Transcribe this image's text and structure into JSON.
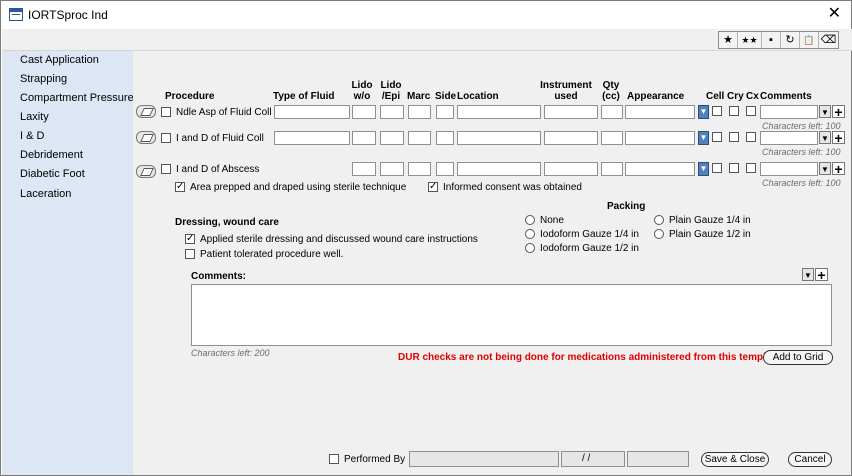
{
  "window": {
    "title": "IORTSproc Ind",
    "close_glyph": "✕"
  },
  "toolbar": {
    "buttons": [
      {
        "name": "favorite-star-icon",
        "glyph": "★"
      },
      {
        "name": "favorites-list-icon",
        "glyph": "★★"
      },
      {
        "name": "save-disk-icon",
        "glyph": "▪"
      },
      {
        "name": "refresh-icon",
        "glyph": "↻"
      },
      {
        "name": "clipboard-check-icon",
        "glyph": "📋"
      },
      {
        "name": "eraser-icon",
        "glyph": "⌫"
      }
    ]
  },
  "sidebar": {
    "items": [
      {
        "label": "Cast Application"
      },
      {
        "label": "Strapping"
      },
      {
        "label": "Compartment Pressures"
      },
      {
        "label": "Laxity"
      },
      {
        "label": "I & D"
      },
      {
        "label": "Debridement"
      },
      {
        "label": "Diabetic Foot"
      },
      {
        "label": "Laceration"
      }
    ]
  },
  "grid": {
    "headers": {
      "procedure": "Procedure",
      "type_of_fluid": "Type of Fluid",
      "lido_wo": "Lido w/o",
      "lido_epi": "Lido /Epi",
      "marc": "Marc",
      "side": "Side",
      "location": "Location",
      "instrument_used": "Instrument used",
      "qty": "Qty (cc)",
      "appearance": "Appearance",
      "cell": "Cell",
      "cry": "Cry",
      "cx": "Cx",
      "comments": "Comments"
    },
    "rows": [
      {
        "label": "Ndle Asp of Fluid Coll",
        "chars_left": "Characters left: 100"
      },
      {
        "label": "I and D of Fluid Coll",
        "chars_left": "Characters left: 100"
      },
      {
        "label": "I and D of Abscess",
        "chars_left": "Characters left: 100"
      }
    ]
  },
  "checks": {
    "prepped": {
      "label": "Area prepped and draped using sterile technique",
      "checked": true
    },
    "consent": {
      "label": "Informed consent was obtained",
      "checked": true
    }
  },
  "dressing": {
    "title": "Dressing, wound care",
    "options": [
      {
        "label": "Applied sterile dressing and discussed wound care instructions",
        "checked": true
      },
      {
        "label": "Patient tolerated procedure well.",
        "checked": false
      }
    ]
  },
  "packing": {
    "title": "Packing",
    "left_options": [
      "None",
      "Iodoform Gauze 1/4 in",
      "Iodoform Gauze 1/2 in"
    ],
    "right_options": [
      "Plain Gauze 1/4 in",
      "Plain Gauze 1/2 in"
    ]
  },
  "comments": {
    "label": "Comments:",
    "chars_left": "Characters left: 200"
  },
  "warning": "DUR checks are not being done for medications administered from this template.",
  "buttons": {
    "add_to_grid": "Add to Grid",
    "save_close": "Save & Close",
    "cancel": "Cancel"
  },
  "performed_by": {
    "label": "Performed By",
    "date_value": " / /"
  },
  "colors": {
    "sidebar_bg": "#dce6f5",
    "content_bg": "#f0f0f0",
    "warning": "#e00000",
    "accent": "#4f81bd"
  }
}
